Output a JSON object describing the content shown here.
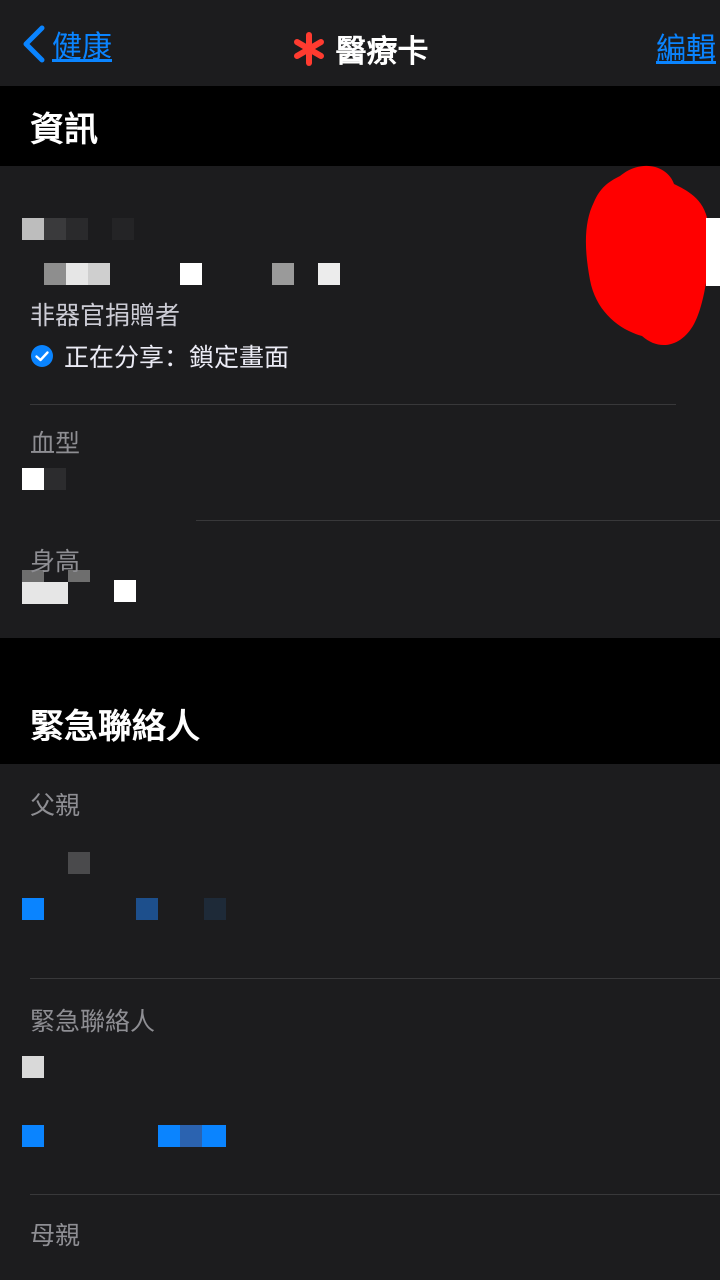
{
  "nav": {
    "back_label": "健康",
    "title": "醫療卡",
    "edit_label": "編輯"
  },
  "sections": {
    "info": {
      "header": "資訊",
      "organ_donor": "非器官捐贈者",
      "sharing_status": "正在分享：鎖定畫面",
      "blood_type_label": "血型",
      "height_label": "身高"
    },
    "emergency": {
      "header": "緊急聯絡人",
      "contacts": [
        {
          "relationship": "父親"
        },
        {
          "relationship": "緊急聯絡人"
        },
        {
          "relationship": "母親"
        }
      ]
    }
  },
  "colors": {
    "accent": "#0a84ff",
    "medical_asterisk": "#ff3b30",
    "redaction": "#ff0000",
    "background": "#1c1c1e",
    "section_header_bg": "#000000"
  }
}
